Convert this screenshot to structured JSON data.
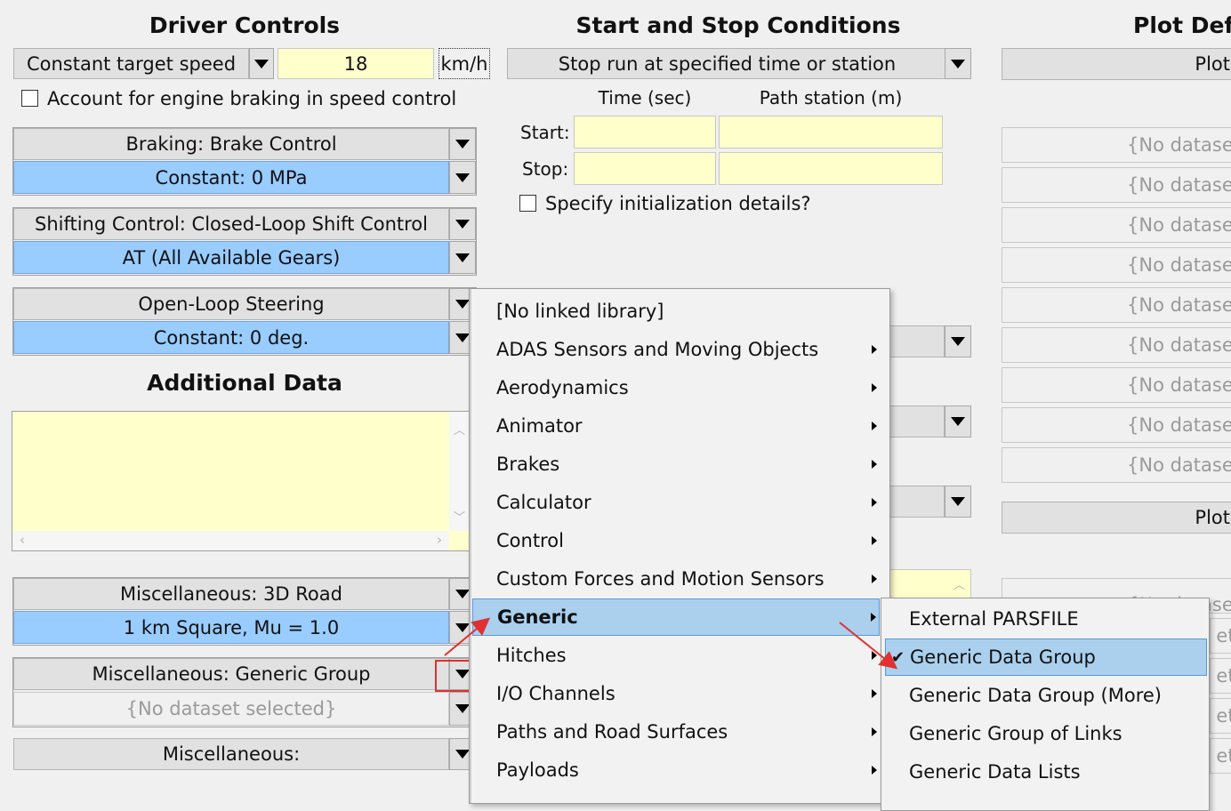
{
  "driver": {
    "heading": "Driver Controls",
    "speed_mode": "Constant target speed",
    "speed_value": "18",
    "speed_unit": "km/h",
    "engine_braking_label": "Account for engine braking in speed control",
    "braking_label": "Braking: Brake Control",
    "braking_value": "Constant: 0 MPa",
    "shifting_label": "Shifting Control: Closed-Loop Shift Control",
    "shifting_value": "AT (All Available Gears)",
    "steering_label": "Open-Loop Steering",
    "steering_value": "Constant: 0 deg."
  },
  "additional": {
    "heading": "Additional Data",
    "road_label": "Miscellaneous: 3D Road",
    "road_value": "1 km Square, Mu = 1.0",
    "generic_label": "Miscellaneous: Generic Group",
    "generic_value": "{No dataset selected}",
    "misc_label": "Miscellaneous:"
  },
  "start_stop": {
    "heading": "Start and Stop Conditions",
    "mode": "Stop run at specified time or station",
    "col_time": "Time (sec)",
    "col_station": "Path station (m)",
    "start_label": "Start:",
    "stop_label": "Stop:",
    "init_label": "Specify initialization details?"
  },
  "plot": {
    "heading": "Plot Defi",
    "button_top": "Plot",
    "dataset_placeholder": "{No dataset",
    "dataset_partial": "{No dataset",
    "button_mid": "Plot",
    "partial_tail": "et",
    "partial_tail_top": "{No dataset"
  },
  "menu": {
    "items": [
      "[No linked library]",
      "ADAS Sensors and Moving Objects",
      "Aerodynamics",
      "Animator",
      "Brakes",
      "Calculator",
      "Control",
      "Custom Forces and Motion Sensors",
      "Generic",
      "Hitches",
      "I/O Channels",
      "Paths and Road Surfaces",
      "Payloads"
    ],
    "selected": "Generic"
  },
  "submenu": {
    "items": [
      "External PARSFILE",
      "Generic Data Group",
      "Generic Data Group (More)",
      "Generic Group of Links",
      "Generic Data Lists"
    ],
    "checked": "Generic Data Group",
    "check_mark": "✔"
  },
  "colors": {
    "highlight_blue": "#99ccff",
    "field_yellow": "#ffffcc",
    "annotation_red": "#e03030"
  }
}
